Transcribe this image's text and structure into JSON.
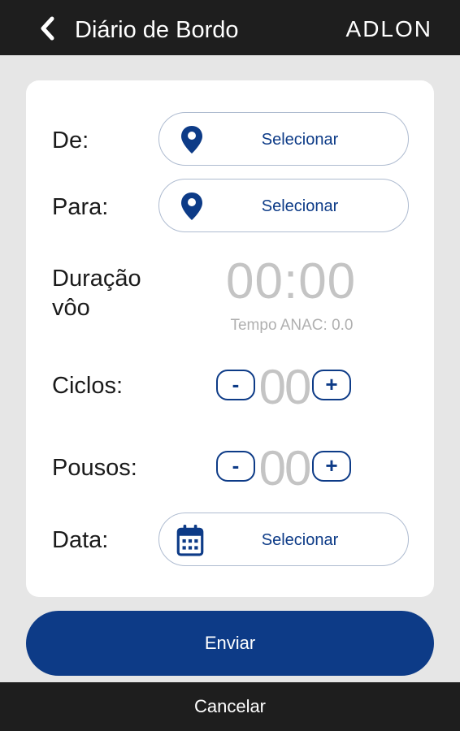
{
  "header": {
    "title": "Diário de Bordo",
    "brand": "ADLON",
    "back_icon": "chevron-left-icon"
  },
  "form": {
    "from": {
      "label": "De:",
      "button_text": "Selecionar",
      "icon": "map-pin-icon"
    },
    "to": {
      "label": "Para:",
      "button_text": "Selecionar",
      "icon": "map-pin-icon"
    },
    "duration": {
      "label_line1": "Duração",
      "label_line2": "vôo",
      "value": "00:00",
      "anac": "Tempo ANAC: 0.0"
    },
    "cycles": {
      "label": "Ciclos:",
      "value": "00",
      "minus": "-",
      "plus": "+"
    },
    "landings": {
      "label": "Pousos:",
      "value": "00",
      "minus": "-",
      "plus": "+"
    },
    "date": {
      "label": "Data:",
      "button_text": "Selecionar",
      "icon": "calendar-icon"
    }
  },
  "actions": {
    "send": "Enviar",
    "cancel": "Cancelar"
  },
  "colors": {
    "primary": "#0d3b87",
    "bar": "#1e1e1e",
    "background": "#e6e6e6",
    "muted": "#c4c4c4"
  }
}
